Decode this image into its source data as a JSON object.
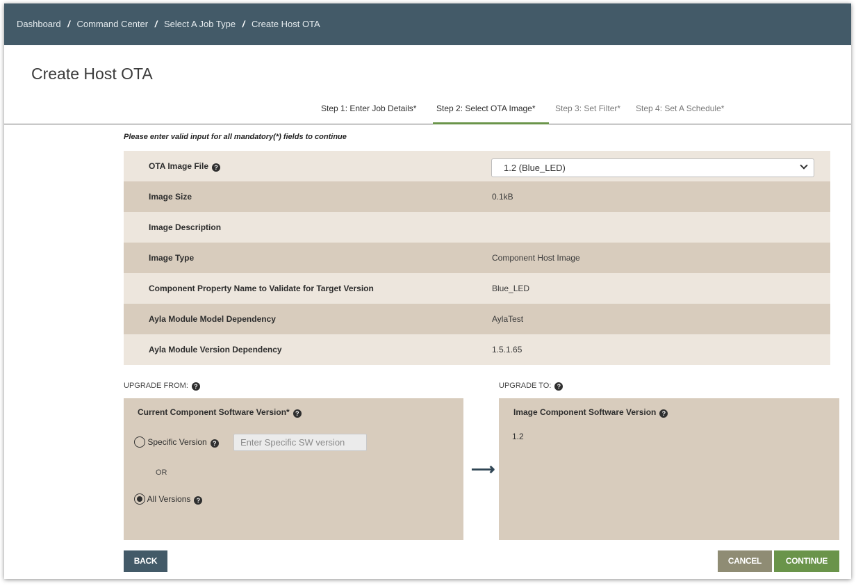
{
  "breadcrumb": {
    "items": [
      "Dashboard",
      "Command Center",
      "Select A Job Type",
      "Create Host OTA"
    ],
    "separator": "/"
  },
  "page_title": "Create Host OTA",
  "steps": [
    {
      "label": "Step 1: Enter Job Details*",
      "state": "done"
    },
    {
      "label": "Step 2: Select OTA Image*",
      "state": "active"
    },
    {
      "label": "Step 3: Set Filter*",
      "state": "pending"
    },
    {
      "label": "Step 4: Set A Schedule*",
      "state": "pending"
    }
  ],
  "mandatory_note": "Please enter valid input for all mandatory(*) fields to continue",
  "details": {
    "ota_image_file": {
      "label": "OTA Image File",
      "selected": "1.2 (Blue_LED)"
    },
    "image_size": {
      "label": "Image Size",
      "value": "0.1kB"
    },
    "image_description": {
      "label": "Image Description",
      "value": ""
    },
    "image_type": {
      "label": "Image Type",
      "value": "Component Host Image"
    },
    "component_property": {
      "label": "Component Property Name to Validate for Target Version",
      "value": "Blue_LED"
    },
    "module_model": {
      "label": "Ayla Module Model Dependency",
      "value": "AylaTest"
    },
    "module_version": {
      "label": "Ayla Module Version Dependency",
      "value": "1.5.1.65"
    }
  },
  "upgrade_from": {
    "label": "UPGRADE FROM:",
    "title": "Current Component Software Version*",
    "specific_version_label": "Specific Version",
    "specific_version_placeholder": "Enter Specific SW version",
    "specific_version_checked": false,
    "or_label": "OR",
    "all_versions_label": "All Versions",
    "all_versions_checked": true
  },
  "upgrade_to": {
    "label": "UPGRADE TO:",
    "title": "Image Component Software Version",
    "value": "1.2"
  },
  "buttons": {
    "back": "BACK",
    "cancel": "CANCEL",
    "continue": "CONTINUE"
  },
  "colors": {
    "topbar": "#435a68",
    "accent_green": "#6a944a",
    "row_light": "#ede6dd",
    "row_dark": "#d8ccbd",
    "cancel": "#8f8c74"
  },
  "icons": {
    "help": "question-circle-icon",
    "arrow": "arrow-right-icon",
    "dropdown": "chevron-down-icon"
  }
}
